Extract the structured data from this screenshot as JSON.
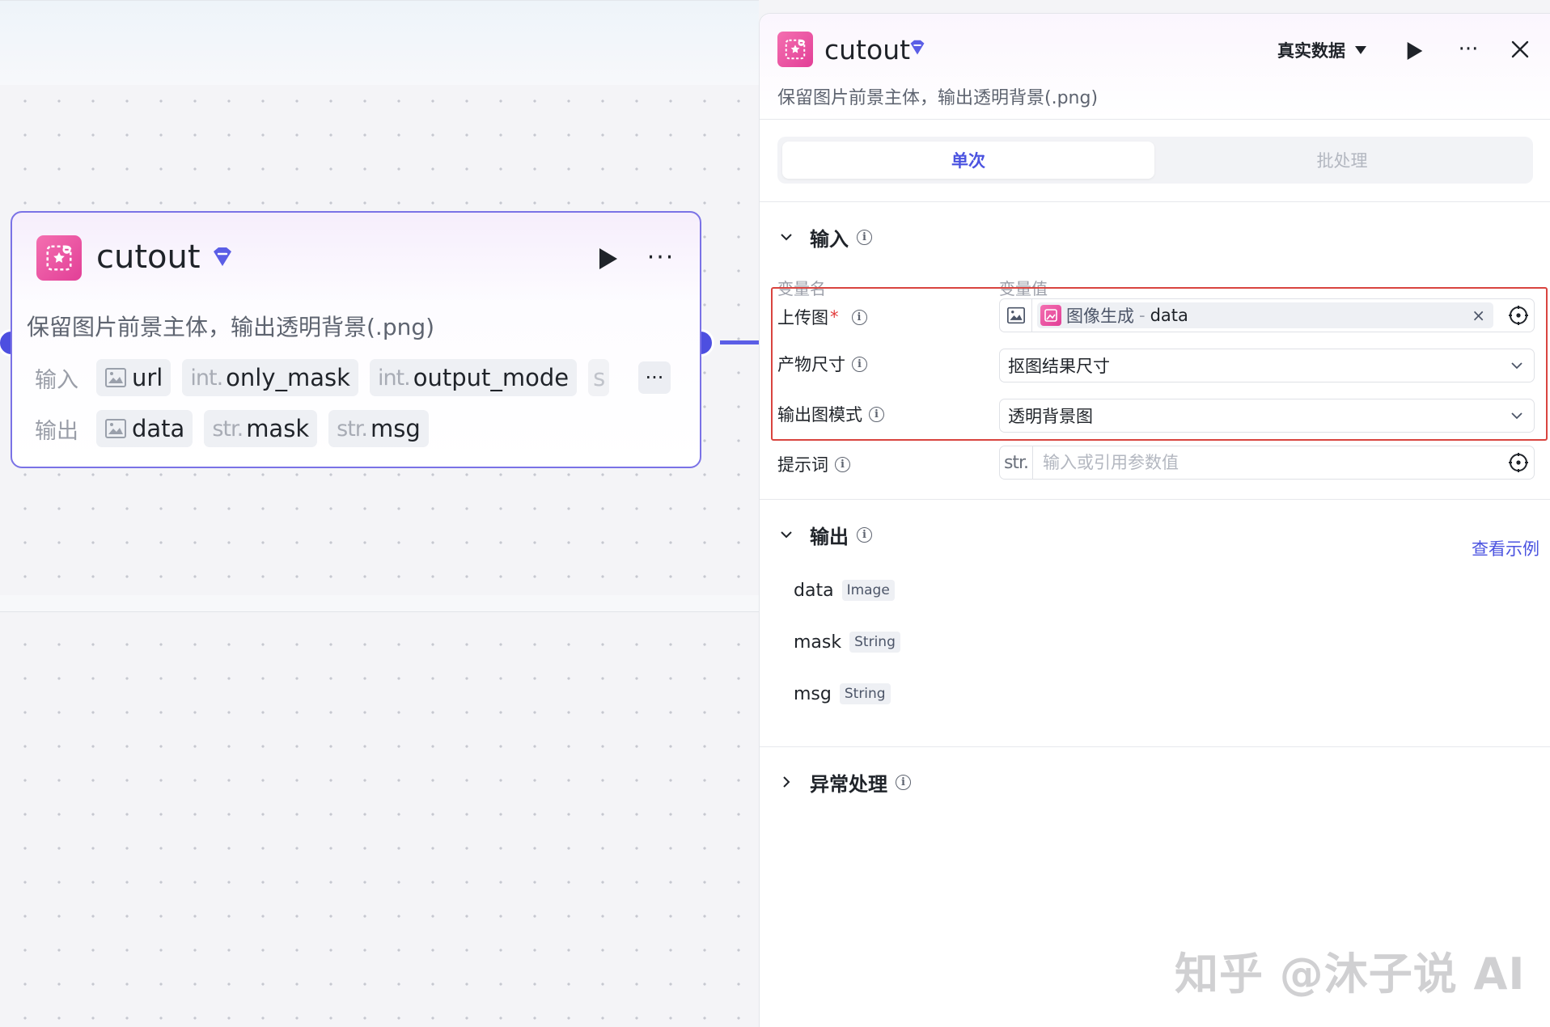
{
  "node": {
    "title": "cutout",
    "description": "保留图片前景主体，输出透明背景(.png)",
    "input_label": "输入",
    "output_label": "输出",
    "inputs": [
      {
        "type": "",
        "name": "url",
        "icon": "image-icon"
      },
      {
        "type": "int.",
        "name": "only_mask"
      },
      {
        "type": "int.",
        "name": "output_mode"
      }
    ],
    "input_faded": "s",
    "outputs": [
      {
        "type": "",
        "name": "data",
        "icon": "image-icon"
      },
      {
        "type": "str.",
        "name": "mask"
      },
      {
        "type": "str.",
        "name": "msg"
      }
    ],
    "more": "···",
    "row_more": "···"
  },
  "panel": {
    "title": "cutout",
    "description": "保留图片前景主体，输出透明背景(.png)",
    "data_source": "真实数据",
    "more": "···",
    "tabs": {
      "single": "单次",
      "batch": "批处理"
    },
    "input_section": {
      "title": "输入",
      "col_name": "变量名",
      "col_value": "变量值",
      "fields": {
        "upload": {
          "label": "上传图",
          "required": "*",
          "ref_source": "图像生成",
          "ref_sep": "-",
          "ref_var": "data",
          "clear": "×"
        },
        "size": {
          "label": "产物尺寸",
          "value": "抠图结果尺寸"
        },
        "mode": {
          "label": "输出图模式",
          "value": "透明背景图"
        },
        "prompt": {
          "label": "提示词",
          "type": "str.",
          "placeholder": "输入或引用参数值"
        }
      }
    },
    "output_section": {
      "title": "输出",
      "view_example": "查看示例",
      "items": [
        {
          "name": "data",
          "type": "Image"
        },
        {
          "name": "mask",
          "type": "String"
        },
        {
          "name": "msg",
          "type": "String"
        }
      ]
    },
    "exception_section": {
      "title": "异常处理"
    }
  },
  "watermark": "知乎 @沐子说 AI",
  "colors": {
    "accent": "#4b53e0",
    "node_border": "#7a72e6",
    "port": "#4d4fe0",
    "icon_pink": "#e23f97",
    "highlight": "#d9443f"
  }
}
